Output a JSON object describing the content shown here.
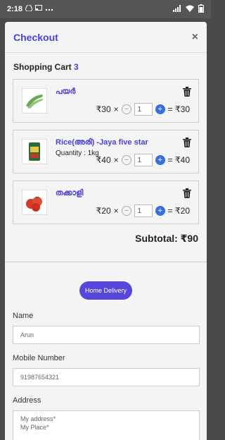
{
  "status": {
    "time": "2:18",
    "notif_icons": [
      "drive-icon",
      "cast-icon",
      "more-icon"
    ]
  },
  "modal": {
    "title": "Checkout",
    "close_label": "×"
  },
  "cart": {
    "heading": "Shopping Cart",
    "count": "3",
    "items": [
      {
        "name": "പയർ",
        "quantity_label": "",
        "unit_price": "₹30",
        "times": "×",
        "qty": "1",
        "equals_total": "= ₹30",
        "image": "beans-image"
      },
      {
        "name": "Rice(അരി) -Jaya five star",
        "quantity_label": "Quantity : 1kg",
        "unit_price": "₹40",
        "times": "×",
        "qty": "1",
        "equals_total": "= ₹40",
        "image": "rice-bag-image"
      },
      {
        "name": "തക്കാളി",
        "quantity_label": "",
        "unit_price": "₹20",
        "times": "×",
        "qty": "1",
        "equals_total": "= ₹20",
        "image": "tomato-image"
      }
    ],
    "subtotal": "Subtotal: ₹90"
  },
  "delivery": {
    "button_label": "Home Delivery"
  },
  "form": {
    "name_label": "Name",
    "name_value": "Arun",
    "mobile_label": "Mobile Number",
    "mobile_value": "91987654321",
    "address_label": "Address",
    "address_line1": "My address*",
    "address_line2": "My Place*"
  },
  "colors": {
    "accent": "#4b3fd6",
    "button": "#5646dc",
    "plus": "#3a6fd8"
  }
}
